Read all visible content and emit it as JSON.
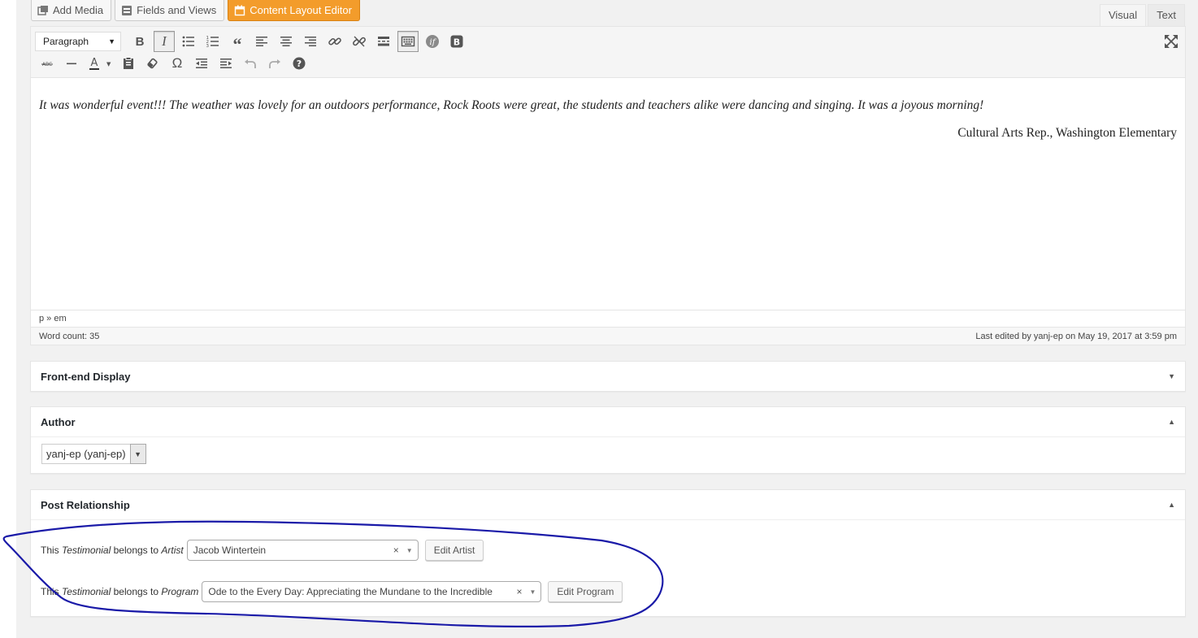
{
  "media_buttons": [
    {
      "label": "Add Media",
      "icon": "media-icon"
    },
    {
      "label": "Fields and Views",
      "icon": "fields-views-icon"
    },
    {
      "label": "Content Layout Editor",
      "icon": "calendar-layout-icon"
    }
  ],
  "editor_tabs": {
    "visual": "Visual",
    "text": "Text",
    "active": "visual"
  },
  "toolbar": {
    "format_select": "Paragraph",
    "row1_icons": [
      "bold-icon",
      "italic-icon",
      "bulleted-list-icon",
      "numbered-list-icon",
      "blockquote-icon",
      "align-left-icon",
      "align-center-icon",
      "align-right-icon",
      "link-icon",
      "unlink-icon",
      "read-more-icon",
      "toolbar-toggle-icon",
      "toolset-conditional-icon",
      "bootstrap-icon"
    ],
    "row2_icons": [
      "strikethrough-icon",
      "horizontal-line-icon",
      "text-color-icon",
      "paste-as-text-icon",
      "clear-formatting-icon",
      "special-character-icon",
      "outdent-icon",
      "indent-icon",
      "undo-icon",
      "redo-icon",
      "help-icon"
    ],
    "pressed": [
      "italic-icon",
      "toolbar-toggle-icon"
    ]
  },
  "editor": {
    "paragraph": "It was wonderful event!!!  The weather was lovely  for an outdoors performance, Rock Roots were great, the students and teachers alike were dancing and singing.  It was a joyous morning!",
    "signature": "Cultural Arts Rep., Washington Elementary",
    "path": "p » em",
    "word_count": "Word count: 35",
    "last_edited": "Last edited by yanj-ep on May 19, 2017 at 3:59 pm"
  },
  "metaboxes": {
    "frontend": {
      "title": "Front-end Display",
      "state": "collapsed"
    },
    "author": {
      "title": "Author",
      "state": "expanded",
      "selected": "yanj-ep (yanj-ep)"
    },
    "relationship": {
      "title": "Post Relationship",
      "state": "expanded",
      "artist": {
        "prefix": "This",
        "post_type": "Testimonial",
        "middle": "belongs to",
        "target": "Artist",
        "value": "Jacob Wintertein",
        "button": "Edit Artist"
      },
      "program": {
        "prefix": "This",
        "post_type": "Testimonial",
        "middle": "belongs to",
        "target": "Program",
        "value": "Ode to the Every Day: Appreciating the Mundane to the Incredible",
        "button": "Edit Program"
      }
    }
  },
  "colors": {
    "accent_orange": "#f39c2b",
    "annotation_blue": "#1a1aa8"
  }
}
